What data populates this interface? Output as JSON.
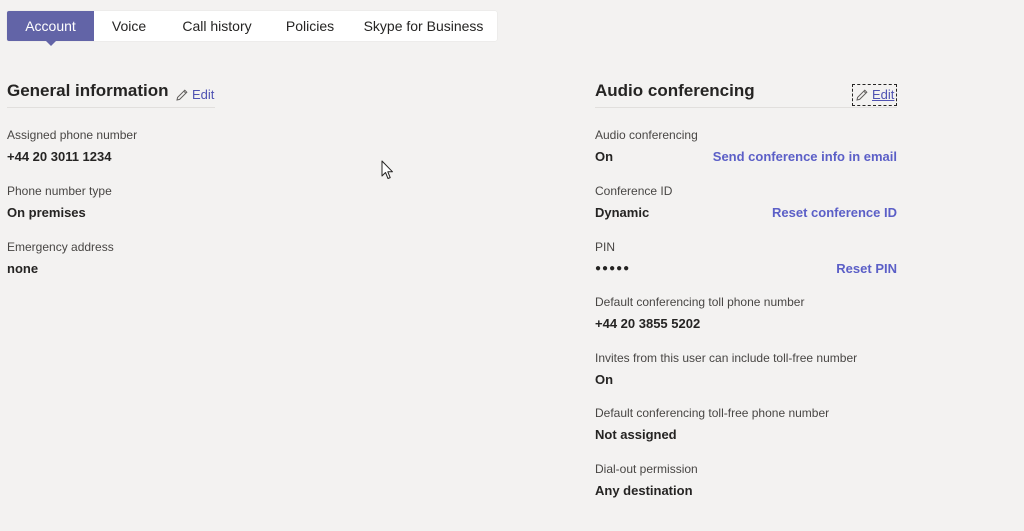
{
  "tabs": [
    {
      "label": "Account",
      "active": true
    },
    {
      "label": "Voice",
      "active": false
    },
    {
      "label": "Call history",
      "active": false
    },
    {
      "label": "Policies",
      "active": false
    },
    {
      "label": "Skype for Business",
      "active": false
    }
  ],
  "general": {
    "title": "General information",
    "edit_label": "Edit",
    "fields": [
      {
        "label": "Assigned phone number",
        "value": "+44 20 3011 1234"
      },
      {
        "label": "Phone number type",
        "value": "On premises"
      },
      {
        "label": "Emergency address",
        "value": "none"
      }
    ]
  },
  "audio": {
    "title": "Audio conferencing",
    "edit_label": "Edit",
    "fields": [
      {
        "label": "Audio conferencing",
        "value": "On",
        "action": "Send conference info in email"
      },
      {
        "label": "Conference ID",
        "value": "Dynamic",
        "action": "Reset conference ID"
      },
      {
        "label": "PIN",
        "value": "●●●●●",
        "action": "Reset PIN"
      },
      {
        "label": "Default conferencing toll phone number",
        "value": "+44 20 3855 5202"
      },
      {
        "label": "Invites from this user can include toll-free number",
        "value": "On"
      },
      {
        "label": "Default conferencing toll-free phone number",
        "value": "Not assigned"
      },
      {
        "label": "Dial-out permission",
        "value": "Any destination"
      }
    ]
  },
  "colors": {
    "accent": "#6264a7",
    "link": "#5b5fc7",
    "background": "#f3f2f1"
  },
  "icons": {
    "edit": "pencil-icon",
    "cursor": "mouse-pointer-icon"
  }
}
